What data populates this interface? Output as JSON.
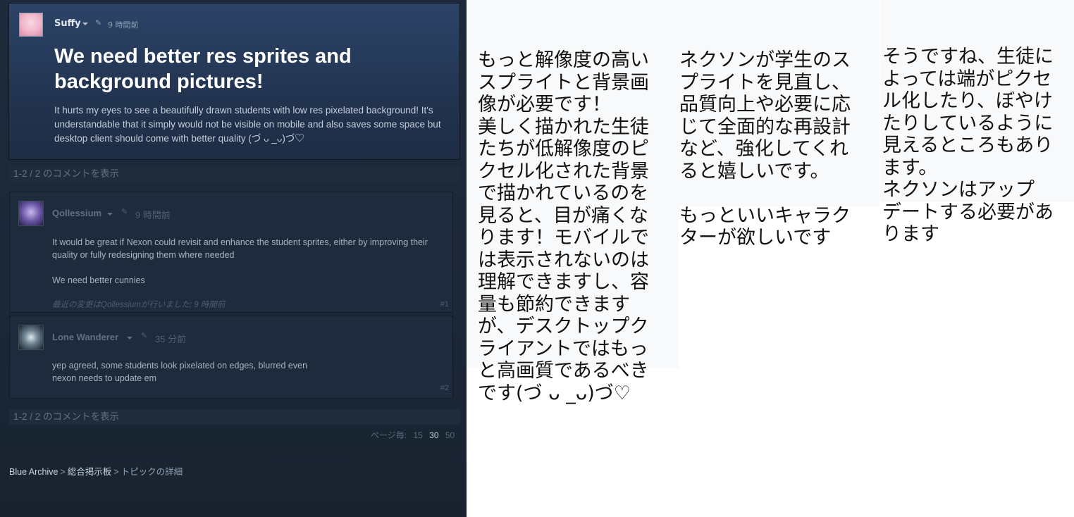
{
  "original_post": {
    "author": "Suffy",
    "time": "9 時間前",
    "title": "We need better res sprites and background pictures!",
    "body": "It hurts my eyes to see a beautifully drawn students with low res pixelated background! It's understandable that it simply would not be visible on mobile and also saves some space but desktop client should come with better quality (づ ᴗ _ᴗ)づ♡"
  },
  "comment_count_top": "1-2 / 2 のコメントを表示",
  "comment_count_bottom": "1-2 / 2 のコメントを表示",
  "comments": [
    {
      "author": "Qollessium",
      "time": "9 時間前",
      "text1": "It would be great if Nexon could revisit and enhance the student sprites, either by improving their quality or fully redesigning them where needed",
      "text2": "We need better cunnies",
      "edited": "最近の変更はQollessiumが行いました; 9 時間前",
      "number": "#1"
    },
    {
      "author": "Lone Wanderer",
      "time": "35 分前",
      "text1": "yep agreed, some students look pixelated on edges, blurred even\nnexon needs to update em",
      "number": "#2"
    }
  ],
  "per_page": {
    "label": "ページ毎:",
    "options": [
      "15",
      "30",
      "50"
    ],
    "active": "30"
  },
  "breadcrumb": {
    "game": "Blue Archive",
    "forum": "総合掲示板",
    "current": "トピックの詳細",
    "separator": ">"
  },
  "translations": [
    "もっと解像度の高い\nスプライトと背景画\n像が必要です！\n美しく描かれた生徒\nたちが低解像度のピ\nクセル化された背景\nで描かれているのを\n見ると、目が痛くな\nります！モバイルで\nは表示されないのは\n理解できますし、容\n量も節約できます\nが、デスクトップク\nライアントではもっ\nと高画質であるべき\nです(づ ᴗ _ᴗ)づ♡",
    "ネクソンが学生のス\nプライトを見直し、\n品質向上や必要に応\nじて全面的な再設計\nなど、強化してくれ\nると嬉しいです。\n\nもっといいキャラク\nターが欲しいです",
    "そうですね、生徒に\nよっては端がピクセ\nル化したり、ぼやけ\nたりしているように\n見えるところもあり\nます。\nネクソンはアップ\nデートする必要があ\nります"
  ],
  "colors": {
    "steam_bg": "#1b2838",
    "op_bg": "#2c4468",
    "comment_bg": "#1d2b3c",
    "link": "#c6d4e2"
  }
}
